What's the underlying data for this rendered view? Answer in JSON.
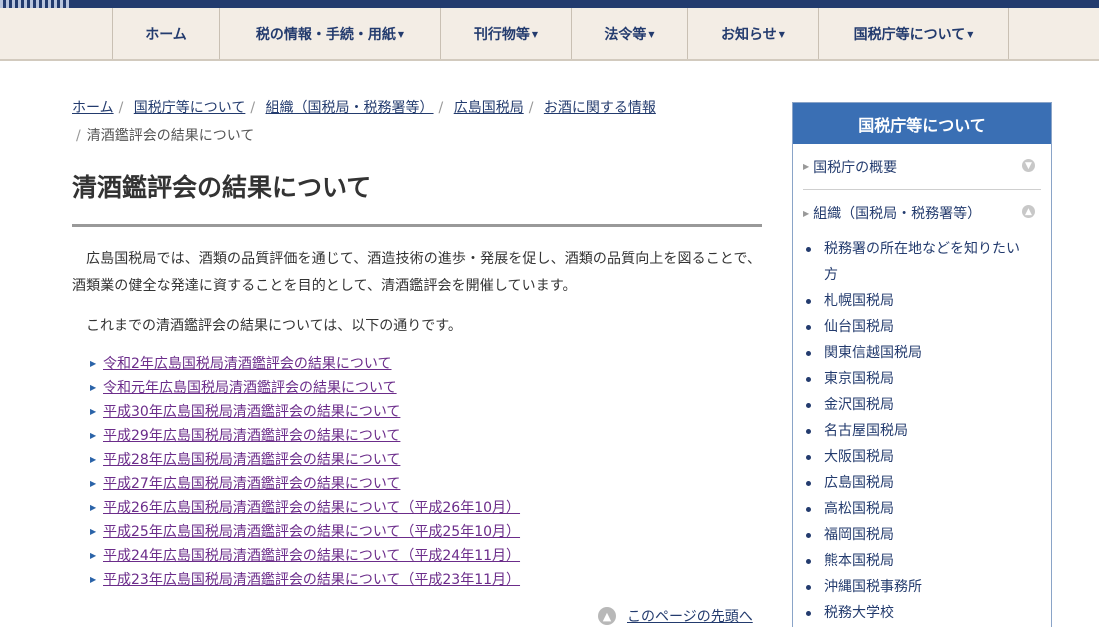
{
  "nav": {
    "items": [
      {
        "label": "ホーム",
        "dropdown": false
      },
      {
        "label": "税の情報・手続・用紙",
        "dropdown": true
      },
      {
        "label": "刊行物等",
        "dropdown": true
      },
      {
        "label": "法令等",
        "dropdown": true
      },
      {
        "label": "お知らせ",
        "dropdown": true
      },
      {
        "label": "国税庁等について",
        "dropdown": true
      }
    ]
  },
  "breadcrumb": {
    "items": [
      "ホーム",
      "国税庁等について",
      "組織（国税局・税務署等）",
      "広島国税局",
      "お酒に関する情報"
    ],
    "current": "清酒鑑評会の結果について"
  },
  "main": {
    "title": "清酒鑑評会の結果について",
    "intro": "広島国税局では、酒類の品質評価を通じて、酒造技術の進歩・発展を促し、酒類の品質向上を図ることで、酒類業の健全な発達に資することを目的として、清酒鑑評会を開催しています。",
    "intro2": "これまでの清酒鑑評会の結果については、以下の通りです。",
    "links": [
      "令和2年広島国税局清酒鑑評会の結果について",
      "令和元年広島国税局清酒鑑評会の結果について",
      "平成30年広島国税局清酒鑑評会の結果について",
      "平成29年広島国税局清酒鑑評会の結果について",
      "平成28年広島国税局清酒鑑評会の結果について",
      "平成27年広島国税局清酒鑑評会の結果について",
      "平成26年広島国税局清酒鑑評会の結果について（平成26年10月）",
      "平成25年広島国税局清酒鑑評会の結果について（平成25年10月）",
      "平成24年広島国税局清酒鑑評会の結果について（平成24年11月）",
      "平成23年広島国税局清酒鑑評会の結果について（平成23年11月）"
    ],
    "page_top": "このページの先頭へ"
  },
  "sidebar": {
    "title": "国税庁等について",
    "sections": [
      "国税庁の概要",
      "組織（国税局・税務署等）"
    ],
    "items": [
      "税務署の所在地などを知りたい方",
      "札幌国税局",
      "仙台国税局",
      "関東信越国税局",
      "東京国税局",
      "金沢国税局",
      "名古屋国税局",
      "大阪国税局",
      "広島国税局",
      "高松国税局",
      "福岡国税局",
      "熊本国税局",
      "沖縄国税事務所",
      "税務大学校"
    ]
  },
  "colors": {
    "navy": "#233b6e",
    "visited_link": "#6b2c8a",
    "sidebar_header": "#3a6fb4",
    "nav_bg": "#f3ede5"
  },
  "icons": {
    "nav_caret": "caret-down-icon",
    "link_bullet": "triangle-right-icon",
    "page_top": "arrow-up-circle-icon",
    "section_toggle_closed": "arrow-down-circle-icon",
    "section_toggle_open": "arrow-up-circle-icon"
  }
}
